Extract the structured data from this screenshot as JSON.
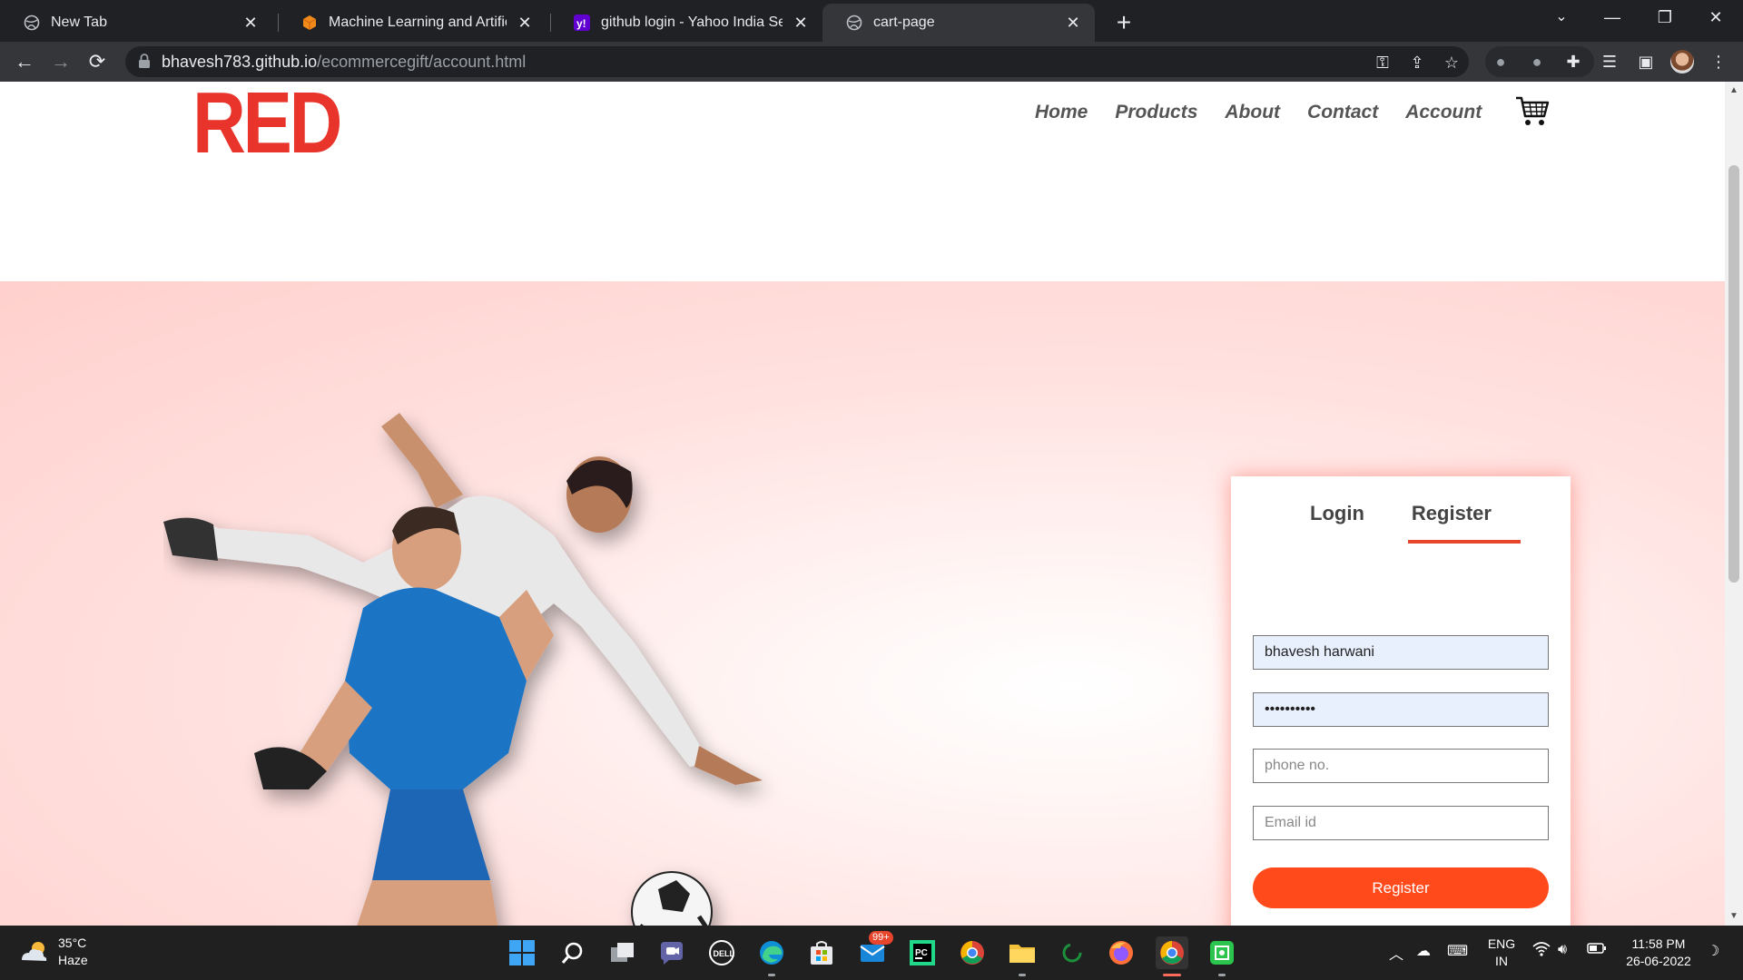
{
  "browser": {
    "tabs": [
      {
        "title": "New Tab",
        "active": false
      },
      {
        "title": "Machine Learning and Artificial Ir",
        "active": false
      },
      {
        "title": "github login - Yahoo India Searc",
        "active": false
      },
      {
        "title": "cart-page",
        "active": true
      }
    ],
    "url_host": "bhavesh783.github.io",
    "url_path": "/ecommercegift/account.html"
  },
  "site": {
    "logo_text": "RED",
    "nav": [
      "Home",
      "Products",
      "About",
      "Contact",
      "Account"
    ]
  },
  "form": {
    "tabs": [
      "Login",
      "Register"
    ],
    "active_tab": "Register",
    "fields": {
      "username_value": "bhavesh harwani",
      "password_value": "••••••••••",
      "phone_placeholder": "phone no.",
      "email_placeholder": "Email id"
    },
    "submit_label": "Register",
    "accent_color": "#ff4a1c"
  },
  "taskbar": {
    "temperature": "35°C",
    "weather": "Haze",
    "mail_badge": "99+",
    "lang_top": "ENG",
    "lang_bottom": "IN",
    "time": "11:58 PM",
    "date": "26-06-2022"
  }
}
